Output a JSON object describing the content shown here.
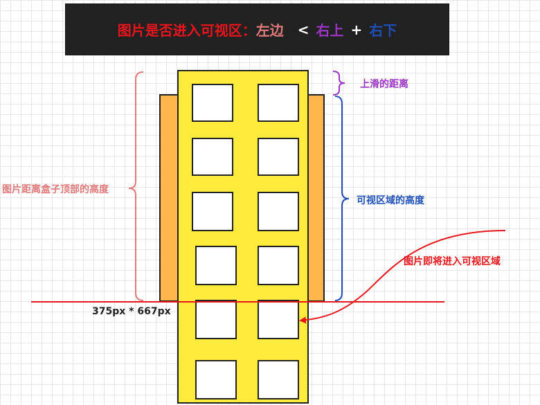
{
  "title": {
    "main": "图片是否进入可视区：",
    "left_part": "左边",
    "less_than": "<",
    "right_top": "右上",
    "plus": "+",
    "right_bottom": "右下"
  },
  "labels": {
    "scroll_distance": "上滑的距离",
    "image_top_distance": "图片距离盒子顶部的高度",
    "visible_height": "可视区域的高度",
    "about_to_enter": "图片即将进入可视区域",
    "viewport_size": "375px * 667px"
  },
  "colors": {
    "title_bg": "#212121",
    "title_main": "#e8151c",
    "left_part": "#e07a7a",
    "right_top": "#9b35c3",
    "right_bottom": "#1f4fb8",
    "scroller_fill": "#ffeb3b",
    "backdrop_fill": "#ffb74d",
    "accent_red": "#e8151c"
  }
}
